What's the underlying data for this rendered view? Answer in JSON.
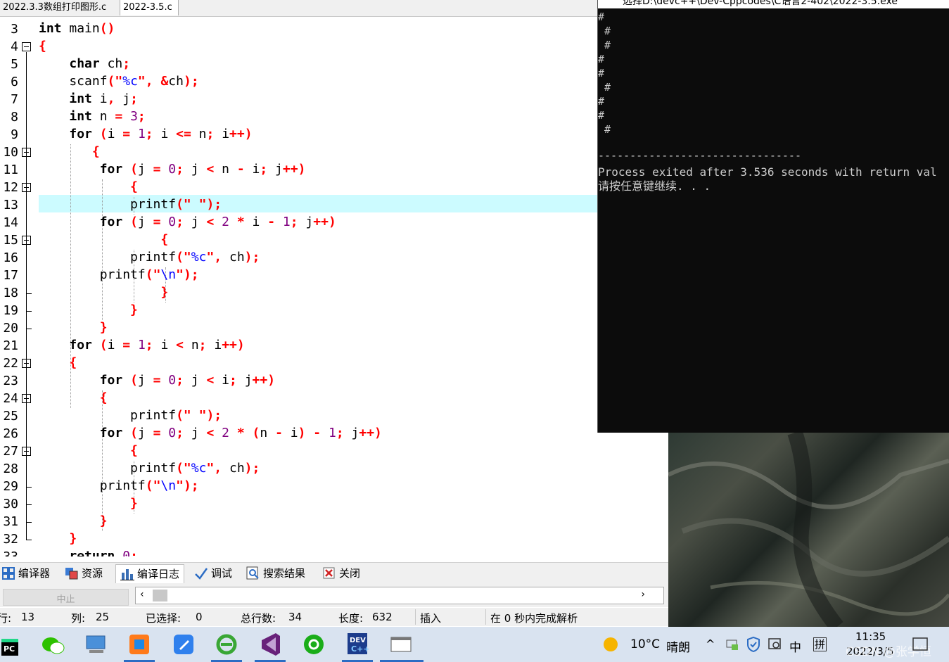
{
  "tabs": [
    {
      "label": "2022.3.3数组打印图形.c",
      "active": false
    },
    {
      "label": "2022-3.5.c",
      "active": true
    }
  ],
  "editor": {
    "line_numbers": [
      "3",
      "4",
      "5",
      "6",
      "7",
      "8",
      "9",
      "10",
      "11",
      "12",
      "13",
      "14",
      "15",
      "16",
      "17",
      "18",
      "19",
      "20",
      "21",
      "22",
      "23",
      "24",
      "25",
      "26",
      "27",
      "28",
      "29",
      "30",
      "31",
      "32",
      "33"
    ],
    "highlighted_line": "13",
    "colors": {
      "keyword": "#000000",
      "symbol": "#ff0000",
      "string": "#0000ff",
      "number": "#800080",
      "highlight": "#ccfbff"
    }
  },
  "bottom_tabs": [
    {
      "label": "编译器",
      "icon": "grid-icon"
    },
    {
      "label": "资源",
      "icon": "resources-icon"
    },
    {
      "label": "编译日志",
      "icon": "bar-chart-icon",
      "active": true
    },
    {
      "label": "调试",
      "icon": "checkmark-icon"
    },
    {
      "label": "搜索结果",
      "icon": "search-icon"
    },
    {
      "label": "关闭",
      "icon": "close-icon"
    }
  ],
  "panel": {
    "abort_label": "中止"
  },
  "status": {
    "row_label": "行:",
    "row_value": "13",
    "col_label": "列:",
    "col_value": "25",
    "sel_label": "已选择:",
    "sel_value": "0",
    "total_label": "总行数:",
    "total_value": "34",
    "len_label": "长度:",
    "len_value": "632",
    "mode": "插入",
    "parse": "在 0 秒内完成解析"
  },
  "console": {
    "title": "选择D:\\devc++\\Dev-Cppcodes\\C语言2-402\\2022-3.5.exe",
    "output_lines": [
      "#",
      " #",
      " #",
      "#",
      "#",
      " #",
      "#",
      "#",
      " #"
    ],
    "separator": "--------------------------------",
    "process_line": "Process exited after 3.536 seconds with return val",
    "continue_line": "请按任意键继续. . ."
  },
  "tray": {
    "temperature": "10°C",
    "weather": "晴朗",
    "ime_lang": "中",
    "ime_mode": "拼",
    "time": "11:35",
    "date": "2022/3/5",
    "watermark": "CSDN @张学恒"
  },
  "taskbar_apps": [
    "pycharm-icon",
    "wechat-icon",
    "computer-icon",
    "office-icon",
    "notes-icon",
    "ie-icon",
    "visual-studio-icon",
    "green-app-icon",
    "devcpp-icon",
    "window-icon"
  ]
}
